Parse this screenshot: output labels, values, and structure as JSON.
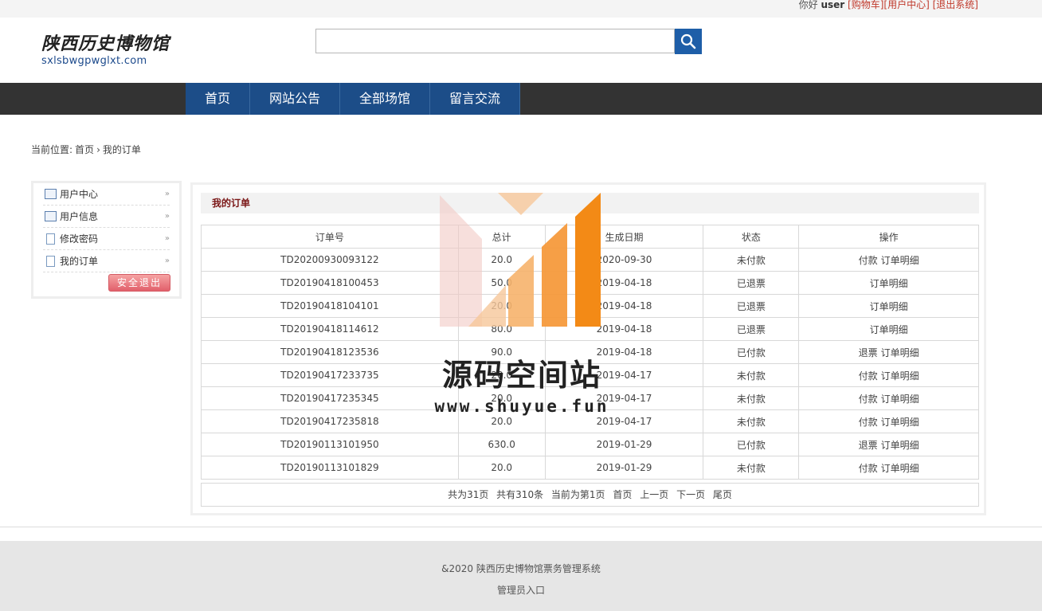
{
  "topbar": {
    "greeting": "你好",
    "username": "user",
    "links": [
      "[购物车]",
      "[用户中心]",
      "[退出系统]"
    ]
  },
  "logo": {
    "cn": "陕西历史博物馆",
    "en": "sxlsbwgpwglxt.com"
  },
  "search": {
    "value": "",
    "button_icon": "search-icon"
  },
  "nav": {
    "items": [
      "首页",
      "网站公告",
      "全部场馆",
      "留言交流"
    ]
  },
  "breadcrumb": {
    "prefix": "当前位置:",
    "home": "首页",
    "separator": "›",
    "current": "我的订单"
  },
  "sidebar": {
    "items": [
      {
        "label": "用户中心",
        "icon": "user-card-icon"
      },
      {
        "label": "用户信息",
        "icon": "user-card-icon"
      },
      {
        "label": "修改密码",
        "icon": "document-icon"
      },
      {
        "label": "我的订单",
        "icon": "document-icon"
      }
    ],
    "logout_label": "安全退出"
  },
  "main": {
    "title": "我的订单",
    "columns": [
      "订单号",
      "总计",
      "生成日期",
      "状态",
      "操作"
    ],
    "rows": [
      {
        "id": "TD20200930093122",
        "total": "20.0",
        "date": "2020-09-30",
        "status": "未付款",
        "actions": [
          "付款",
          "订单明细"
        ]
      },
      {
        "id": "TD20190418100453",
        "total": "50.0",
        "date": "2019-04-18",
        "status": "已退票",
        "actions": [
          "订单明细"
        ]
      },
      {
        "id": "TD20190418104101",
        "total": "20.0",
        "date": "2019-04-18",
        "status": "已退票",
        "actions": [
          "订单明细"
        ]
      },
      {
        "id": "TD20190418114612",
        "total": "80.0",
        "date": "2019-04-18",
        "status": "已退票",
        "actions": [
          "订单明细"
        ]
      },
      {
        "id": "TD20190418123536",
        "total": "90.0",
        "date": "2019-04-18",
        "status": "已付款",
        "actions": [
          "退票",
          "订单明细"
        ]
      },
      {
        "id": "TD20190417233735",
        "total": "20.0",
        "date": "2019-04-17",
        "status": "未付款",
        "actions": [
          "付款",
          "订单明细"
        ]
      },
      {
        "id": "TD20190417235345",
        "total": "20.0",
        "date": "2019-04-17",
        "status": "未付款",
        "actions": [
          "付款",
          "订单明细"
        ]
      },
      {
        "id": "TD20190417235818",
        "total": "20.0",
        "date": "2019-04-17",
        "status": "未付款",
        "actions": [
          "付款",
          "订单明细"
        ]
      },
      {
        "id": "TD20190113101950",
        "total": "630.0",
        "date": "2019-01-29",
        "status": "已付款",
        "actions": [
          "退票",
          "订单明细"
        ]
      },
      {
        "id": "TD20190113101829",
        "total": "20.0",
        "date": "2019-01-29",
        "status": "未付款",
        "actions": [
          "付款",
          "订单明细"
        ]
      }
    ],
    "pager": {
      "total_pages": "共为31页",
      "total_items": "共有310条",
      "current": "当前为第1页",
      "first": "首页",
      "prev": "上一页",
      "next": "下一页",
      "last": "尾页"
    }
  },
  "footer": {
    "copyright": "&2020 陕西历史博物馆票务管理系统",
    "admin_link": "管理员入口"
  },
  "watermark": {
    "text": "源码空间站",
    "url": "www.shuyue.fun"
  },
  "colors": {
    "nav_bg": "#333333",
    "nav_item_bg": "#1c4d88",
    "accent_red": "#c0392b",
    "title_red": "#7a1616",
    "search_btn": "#1e5ea8"
  }
}
